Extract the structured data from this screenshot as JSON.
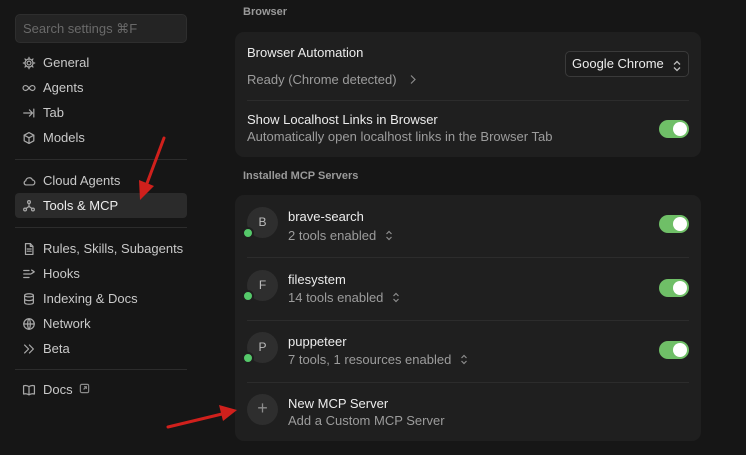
{
  "sidebar": {
    "search_placeholder": "Search settings ⌘F",
    "group1": [
      {
        "label": "General",
        "icon": "gear-icon"
      },
      {
        "label": "Agents",
        "icon": "infinity-icon"
      },
      {
        "label": "Tab",
        "icon": "tab-arrow-icon"
      },
      {
        "label": "Models",
        "icon": "cube-icon"
      }
    ],
    "group2": [
      {
        "label": "Cloud Agents",
        "icon": "cloud-icon"
      },
      {
        "label": "Tools & MCP",
        "icon": "tools-icon",
        "active": true
      }
    ],
    "group3": [
      {
        "label": "Rules, Skills, Subagents",
        "icon": "document-icon"
      },
      {
        "label": "Hooks",
        "icon": "hooks-icon"
      },
      {
        "label": "Indexing & Docs",
        "icon": "database-icon"
      },
      {
        "label": "Network",
        "icon": "globe-icon"
      },
      {
        "label": "Beta",
        "icon": "double-chevron-icon"
      }
    ],
    "group4": [
      {
        "label": "Docs",
        "icon": "book-icon",
        "external": true
      }
    ]
  },
  "browser": {
    "section_title": "Browser",
    "automation": {
      "title": "Browser Automation",
      "status": "Ready (Chrome detected)",
      "select_value": "Google Chrome"
    },
    "localhost": {
      "title": "Show Localhost Links in Browser",
      "subtitle": "Automatically open localhost links in the Browser Tab",
      "enabled": true
    }
  },
  "mcp": {
    "section_title": "Installed MCP Servers",
    "servers": [
      {
        "initial": "B",
        "name": "brave-search",
        "detail": "2 tools enabled",
        "enabled": true
      },
      {
        "initial": "F",
        "name": "filesystem",
        "detail": "14 tools enabled",
        "enabled": true
      },
      {
        "initial": "P",
        "name": "puppeteer",
        "detail": "7 tools, 1 resources enabled",
        "enabled": true
      }
    ],
    "new_server": {
      "title": "New MCP Server",
      "subtitle": "Add a Custom MCP Server"
    }
  },
  "colors": {
    "toggle_on": "#6fbf67",
    "status_dot": "#55c96a",
    "annotation_arrow": "#d0201c"
  }
}
